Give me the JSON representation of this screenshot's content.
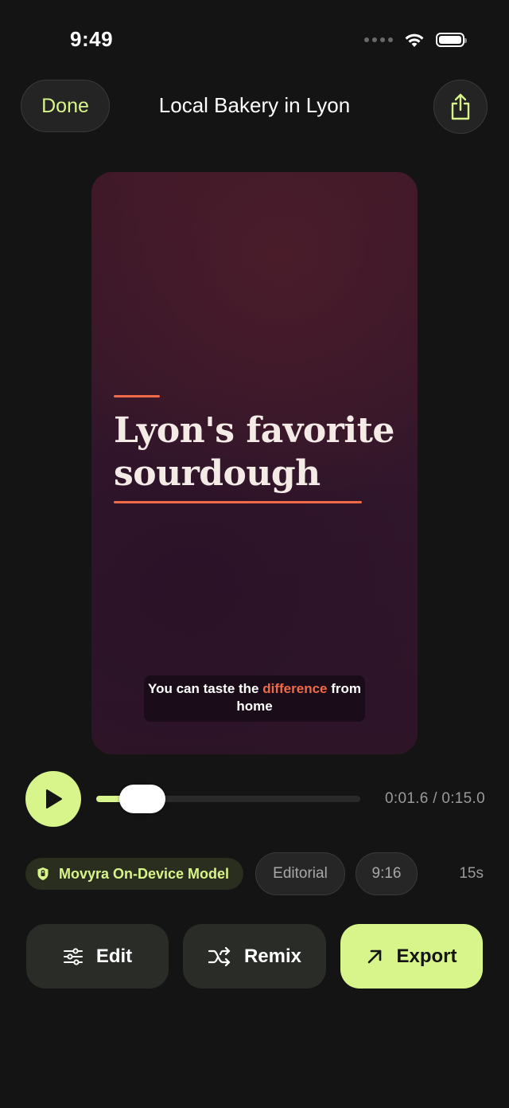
{
  "status_bar": {
    "time": "9:49"
  },
  "header": {
    "done_label": "Done",
    "title": "Local Bakery in Lyon"
  },
  "preview": {
    "headline": "Lyon's favorite sourdough",
    "caption_before": "You can taste the ",
    "caption_highlight": "difference",
    "caption_after": " from home"
  },
  "playback": {
    "time_readout": "0:01.6 / 0:15.0",
    "progress": 0.107
  },
  "chips": {
    "model": "Movyra On-Device Model",
    "style": "Editorial",
    "ratio": "9:16",
    "duration": "15s"
  },
  "actions": {
    "edit": "Edit",
    "remix": "Remix",
    "export": "Export"
  },
  "colors": {
    "accent": "#d7f58a",
    "headline_accent": "#f06a48",
    "background": "#141414"
  }
}
